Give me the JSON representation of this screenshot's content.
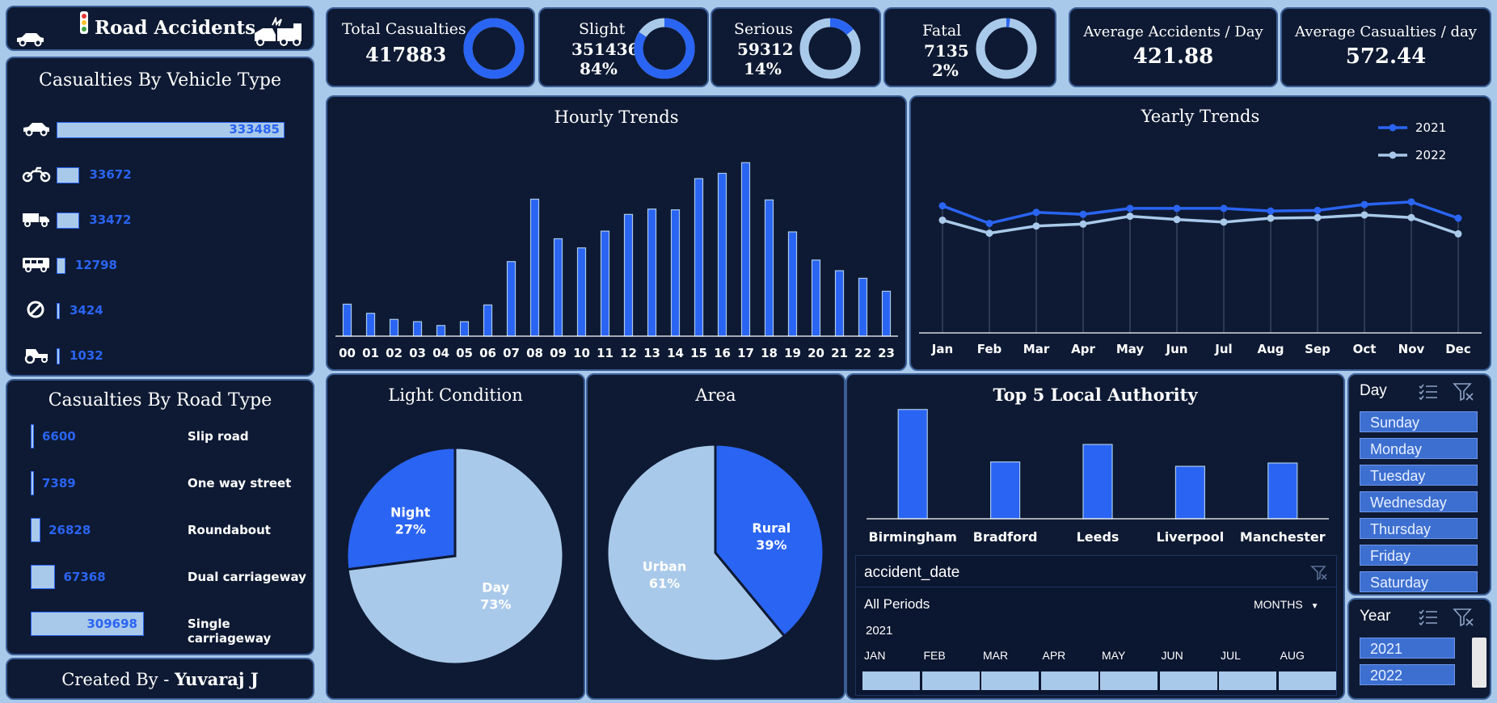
{
  "header": {
    "title": "Road Accidents"
  },
  "kpis": [
    {
      "label": "Total Casualties",
      "value": "417883",
      "pct": "",
      "share": 1.0
    },
    {
      "label": "Slight",
      "value": "351436",
      "pct": "84%",
      "share": 0.84
    },
    {
      "label": "Serious",
      "value": "59312",
      "pct": "14%",
      "share": 0.14
    },
    {
      "label": "Fatal",
      "value": "7135",
      "pct": "2%",
      "share": 0.02
    }
  ],
  "averages": [
    {
      "label": "Average Accidents / Day",
      "value": "421.88"
    },
    {
      "label": "Average Casualties / day",
      "value": "572.44"
    }
  ],
  "vehicle_type": {
    "title": "Casualties By Vehicle Type",
    "items": [
      {
        "icon": "car-icon",
        "value": 333485
      },
      {
        "icon": "motorcycle-icon",
        "value": 33672
      },
      {
        "icon": "truck-icon",
        "value": 33472
      },
      {
        "icon": "bus-icon",
        "value": 12798
      },
      {
        "icon": "other-icon",
        "value": 3424
      },
      {
        "icon": "tractor-icon",
        "value": 1032
      }
    ]
  },
  "road_type": {
    "title": "Casualties By Road Type",
    "items": [
      {
        "label": "Slip road",
        "value": 6600
      },
      {
        "label": "One way street",
        "value": 7389
      },
      {
        "label": "Roundabout",
        "value": 26828
      },
      {
        "label": "Dual carriageway",
        "value": 67368
      },
      {
        "label": "Single carriageway",
        "value": 309698
      }
    ]
  },
  "footer": {
    "prefix": "Created By - ",
    "author": "Yuvaraj J"
  },
  "hourly": {
    "title": "Hourly Trends",
    "chart_data": {
      "type": "bar",
      "categories": [
        "00",
        "01",
        "02",
        "03",
        "04",
        "05",
        "06",
        "07",
        "08",
        "09",
        "10",
        "11",
        "12",
        "13",
        "14",
        "15",
        "16",
        "17",
        "18",
        "19",
        "20",
        "21",
        "22",
        "23"
      ],
      "values": [
        4200,
        3000,
        2200,
        1900,
        1400,
        1900,
        4100,
        9800,
        18000,
        12800,
        11600,
        13800,
        16000,
        16700,
        16600,
        20700,
        21400,
        22800,
        17900,
        13700,
        10000,
        8600,
        7600,
        5900
      ],
      "ylim": [
        0,
        24000
      ]
    }
  },
  "yearly": {
    "title": "Yearly Trends",
    "chart_data": {
      "type": "line",
      "categories": [
        "Jan",
        "Feb",
        "Mar",
        "Apr",
        "May",
        "Jun",
        "Jul",
        "Aug",
        "Sep",
        "Oct",
        "Nov",
        "Dec"
      ],
      "series": [
        {
          "name": "2021",
          "color": "#2a64f2",
          "values": [
            19500,
            16800,
            18500,
            18200,
            19100,
            19100,
            19100,
            18700,
            18800,
            19700,
            20100,
            17600
          ]
        },
        {
          "name": "2022",
          "color": "#a9c9ea",
          "values": [
            17300,
            15300,
            16400,
            16700,
            17900,
            17400,
            17000,
            17600,
            17700,
            18100,
            17700,
            15200
          ]
        }
      ],
      "ylim": [
        0,
        30000
      ],
      "legend": "top-right"
    }
  },
  "light": {
    "title": "Light Condition",
    "chart_data": {
      "type": "pie",
      "slices": [
        {
          "label": "Night",
          "value": 27,
          "pct": "27%",
          "color": "#2a64f2"
        },
        {
          "label": "Day",
          "value": 73,
          "pct": "73%",
          "color": "#a9c9ea"
        }
      ]
    }
  },
  "area": {
    "title": "Area",
    "chart_data": {
      "type": "pie",
      "slices": [
        {
          "label": "Rural",
          "value": 39,
          "pct": "39%",
          "color": "#2a64f2"
        },
        {
          "label": "Urban",
          "value": 61,
          "pct": "61%",
          "color": "#a9c9ea"
        }
      ]
    }
  },
  "top5": {
    "title": "Top 5 Local Authority",
    "chart_data": {
      "type": "bar",
      "categories": [
        "Birmingham",
        "Bradford",
        "Leeds",
        "Liverpool",
        "Manchester"
      ],
      "values": [
        10000,
        5200,
        6800,
        4800,
        5100
      ],
      "ylim": [
        0,
        10500
      ]
    }
  },
  "timeline": {
    "field": "accident_date",
    "period": "All Periods",
    "unit": "MONTHS",
    "year": "2021",
    "months": [
      "JAN",
      "FEB",
      "MAR",
      "APR",
      "MAY",
      "JUN",
      "JUL",
      "AUG"
    ]
  },
  "day_slicer": {
    "title": "Day",
    "items": [
      "Sunday",
      "Monday",
      "Tuesday",
      "Wednesday",
      "Thursday",
      "Friday",
      "Saturday"
    ]
  },
  "year_slicer": {
    "title": "Year",
    "items": [
      "2021",
      "2022"
    ]
  },
  "colors": {
    "accent": "#2a64f2",
    "light": "#a9c9ea",
    "panel": "#0e1a33",
    "background": "#a9c9ea"
  }
}
